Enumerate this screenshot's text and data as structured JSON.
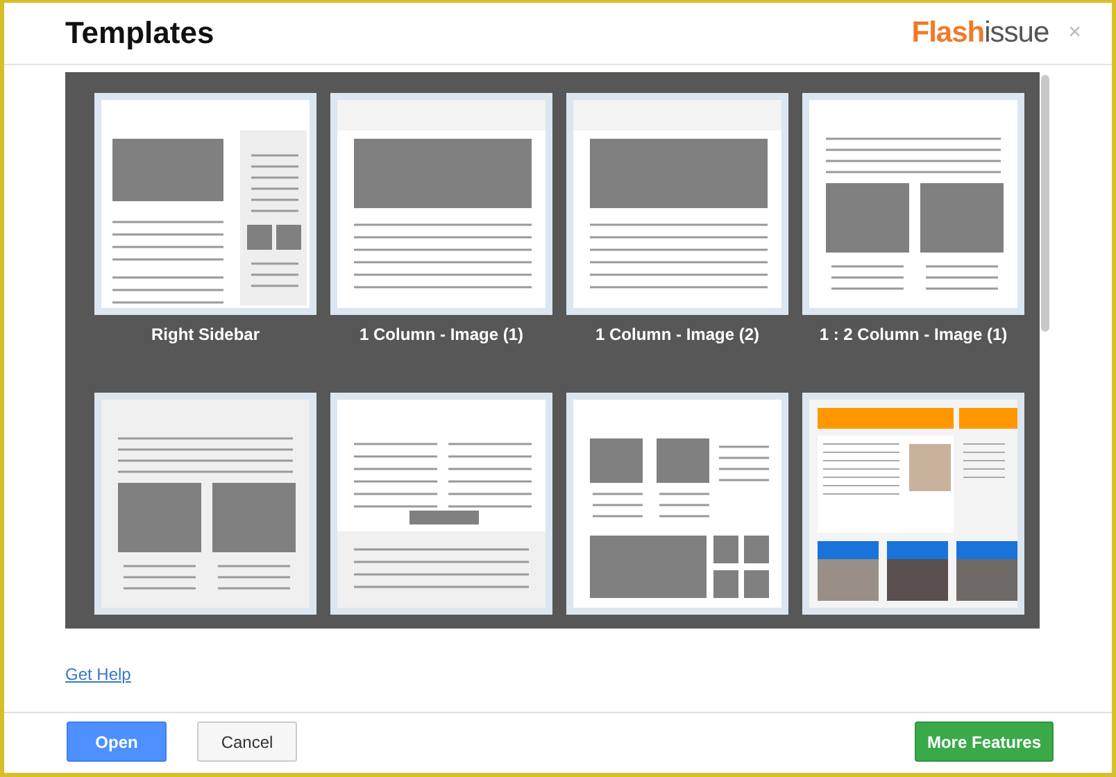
{
  "window": {
    "title": "Templates",
    "logo": {
      "part_1": "Flash",
      "part_2": "issue"
    },
    "close": "×"
  },
  "templates": [
    {
      "kind": "right-sidebar",
      "label": "Right Sidebar"
    },
    {
      "kind": "one-column-a",
      "label": "1 Column - Image (1)"
    },
    {
      "kind": "one-column-b",
      "label": "1 Column - Image (2)"
    },
    {
      "kind": "one-two",
      "label": "1 : 2 Column - Image (1)"
    },
    {
      "kind": "one-two-b"
    },
    {
      "kind": "two-column-text"
    },
    {
      "kind": "blocks"
    },
    {
      "kind": "sample"
    }
  ],
  "help_link": "Get Help",
  "buttons": {
    "open": "Open",
    "cancel": "Cancel",
    "more": "More Features"
  }
}
